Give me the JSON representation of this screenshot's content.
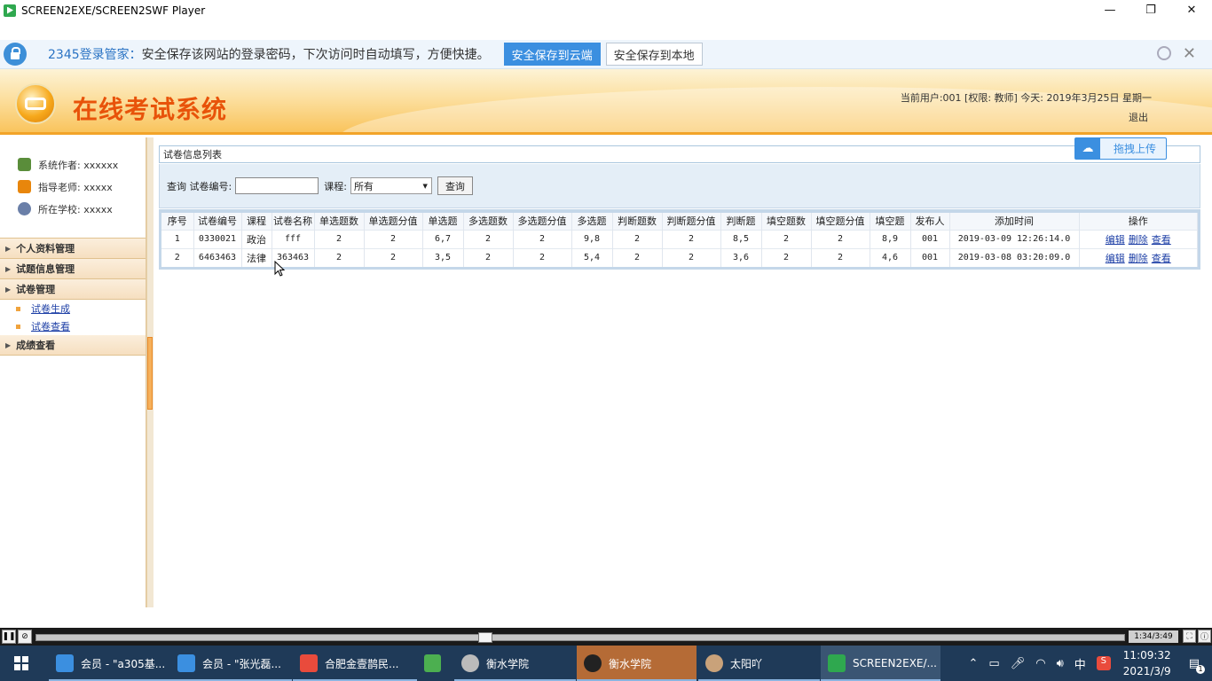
{
  "window": {
    "title": "SCREEN2EXE/SCREEN2SWF Player",
    "min": "—",
    "max": "❐",
    "close": "✕"
  },
  "pwbar": {
    "brand": "2345登录管家：",
    "message": "安全保存该网站的登录密码，下次访问时自动填写，方便快捷。",
    "save_cloud": "安全保存到云端",
    "save_local": "安全保存到本地",
    "close": "✕"
  },
  "header": {
    "title": "在线考试系统",
    "user_info": "当前用户:001 [权限: 教师] 今天: 2019年3月25日 星期一",
    "logout": "退出"
  },
  "sidebar": {
    "info": [
      {
        "label": "系统作者: xxxxxx",
        "icon": "author-icon",
        "color": "#5a8d3a"
      },
      {
        "label": "指导老师: xxxxx",
        "icon": "teacher-icon",
        "color": "#e8860c"
      },
      {
        "label": "所在学校: xxxxx",
        "icon": "school-icon",
        "color": "#6a7fa8"
      }
    ],
    "menus": [
      {
        "label": "个人资料管理"
      },
      {
        "label": "试题信息管理"
      },
      {
        "label": "试卷管理",
        "children": [
          "试卷生成",
          "试卷查看"
        ]
      },
      {
        "label": "成绩查看"
      }
    ]
  },
  "main": {
    "panel_title": "试卷信息列表",
    "upload_label": "拖拽上传",
    "query": {
      "label": "查询",
      "paper_no_label": "试卷编号:",
      "paper_no_value": "",
      "course_label": "课程:",
      "course_selected": "所有",
      "search_button": "查询"
    },
    "table": {
      "headers": [
        "序号",
        "试卷编号",
        "课程",
        "试卷名称",
        "单选题数",
        "单选题分值",
        "单选题",
        "多选题数",
        "多选题分值",
        "多选题",
        "判断题数",
        "判断题分值",
        "判断题",
        "填空题数",
        "填空题分值",
        "填空题",
        "发布人",
        "添加时间",
        "操作"
      ],
      "rows": [
        [
          "1",
          "0330021",
          "政治",
          "fff",
          "2",
          "2",
          "6,7",
          "2",
          "2",
          "9,8",
          "2",
          "2",
          "8,5",
          "2",
          "2",
          "8,9",
          "001",
          "2019-03-09 12:26:14.0"
        ],
        [
          "2",
          "6463463",
          "法律",
          "363463",
          "2",
          "2",
          "3,5",
          "2",
          "2",
          "5,4",
          "2",
          "2",
          "3,6",
          "2",
          "2",
          "4,6",
          "001",
          "2019-03-08 03:20:09.0"
        ]
      ],
      "actions": [
        "编辑",
        "删除",
        "查看"
      ]
    }
  },
  "player": {
    "time": "1:34/3:49"
  },
  "taskbar": {
    "tasks": [
      {
        "label": "会员 - \"a305基...",
        "color": "#3b8fe0"
      },
      {
        "label": "会员 - \"张光磊...",
        "color": "#3b8fe0"
      },
      {
        "label": "合肥金壹鹊民...",
        "color": "#e94b3c"
      },
      {
        "label": "",
        "color": "#4caf50"
      },
      {
        "label": "衡水学院",
        "color": "#bbbbbb"
      },
      {
        "label": "衡水学院",
        "color": "#222222"
      },
      {
        "label": "太阳吖",
        "color": "#c9a27a"
      },
      {
        "label": "SCREEN2EXE/...",
        "color": "#2fa84f"
      }
    ],
    "ime": "中",
    "time": "11:09:32",
    "date": "2021/3/9",
    "notify_count": "1"
  }
}
